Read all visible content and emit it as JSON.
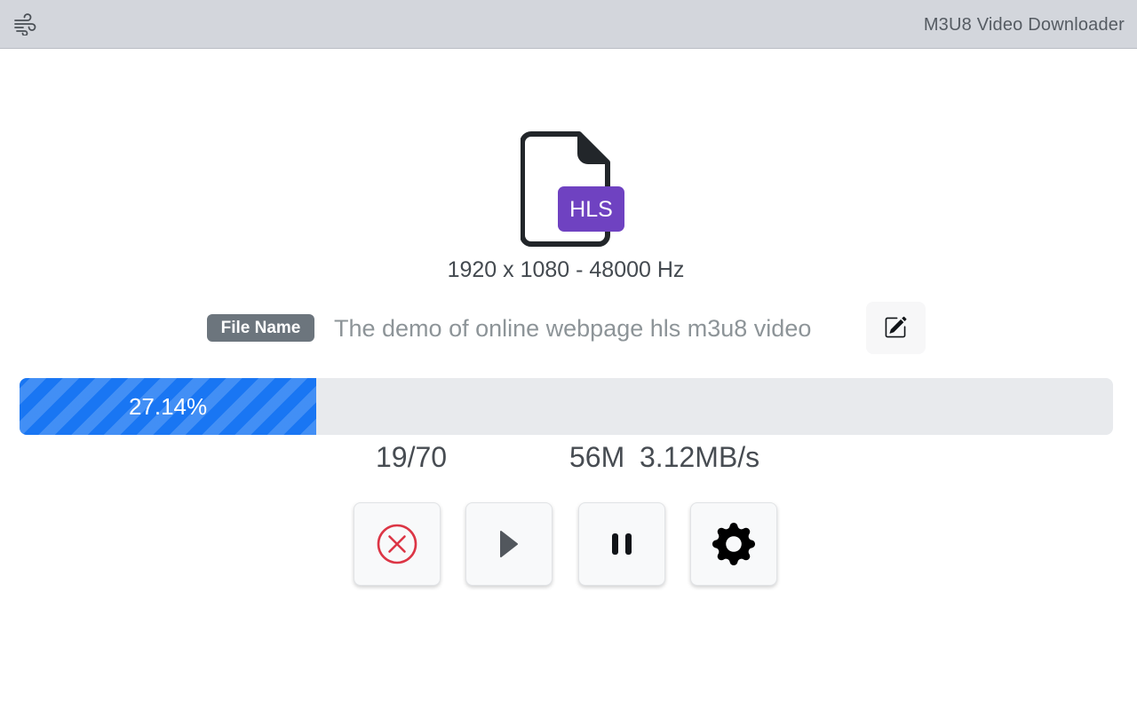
{
  "header": {
    "title": "M3U8 Video Downloader",
    "menu_icon": "wind-icon"
  },
  "file": {
    "badge_text": "HLS",
    "badge_color": "#6f42c1",
    "meta": "1920 x 1080 - 48000 Hz",
    "name_label": "File Name",
    "name_value": "The demo of online webpage hls m3u8 video",
    "edit_icon": "pencil-square-icon"
  },
  "progress": {
    "percent": 27.14,
    "label": "27.14%",
    "color": "#1976f3"
  },
  "stats": {
    "segments": "19/70",
    "size": "56M",
    "speed": "3.12MB/s"
  },
  "controls": {
    "cancel_icon": "x-circle-icon",
    "cancel_color": "#dc3545",
    "play_icon": "play-icon",
    "pause_icon": "pause-icon",
    "settings_icon": "gear-icon"
  }
}
